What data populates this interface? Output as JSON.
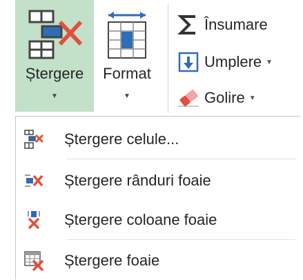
{
  "ribbon": {
    "delete_button": {
      "label": "Ștergere",
      "icon": "delete-cells-icon"
    },
    "format_button": {
      "label": "Format",
      "icon": "format-cells-icon"
    },
    "sum_button": {
      "label": "Însumare",
      "icon": "sigma-icon"
    },
    "fill_button": {
      "label": "Umplere",
      "icon": "fill-down-icon"
    },
    "clear_button": {
      "label": "Golire",
      "icon": "eraser-icon"
    }
  },
  "menu": {
    "items": [
      {
        "label": "Ștergere celule...",
        "icon": "delete-cells-icon"
      },
      {
        "label": "Ștergere rânduri foaie",
        "icon": "delete-rows-icon"
      },
      {
        "label": "Ștergere coloane foaie",
        "icon": "delete-columns-icon"
      },
      {
        "label": "Ștergere foaie",
        "icon": "delete-sheet-icon"
      }
    ]
  },
  "colors": {
    "active_button_bg": "#c3e0c9",
    "delete_x": "#e0503c",
    "icon_blue": "#2f6db5"
  }
}
